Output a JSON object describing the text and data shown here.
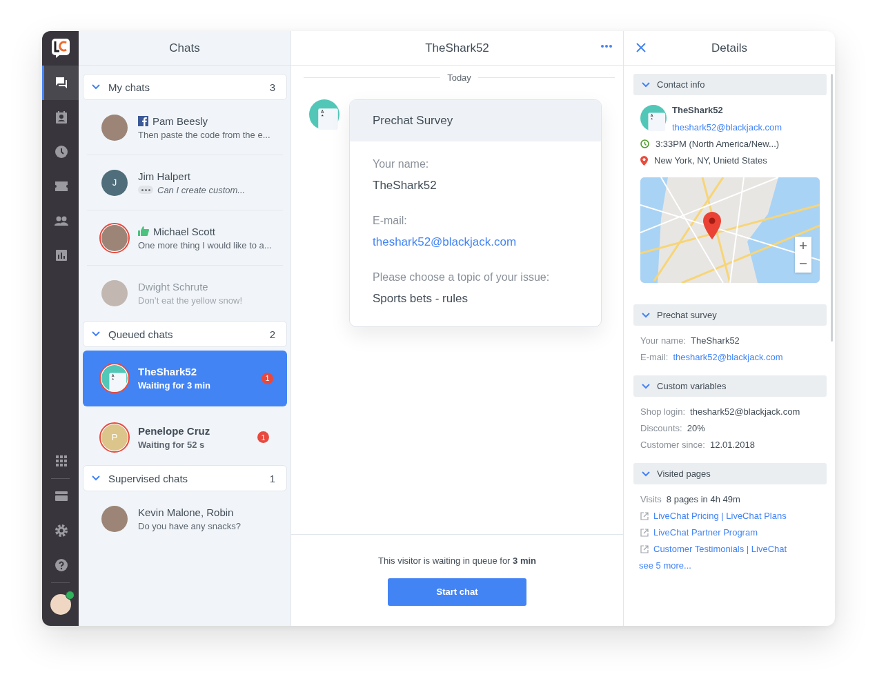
{
  "nav": {
    "items": [
      {
        "kind": "chats",
        "selected": true
      },
      {
        "kind": "contacts",
        "selected": false
      },
      {
        "kind": "history",
        "selected": false
      },
      {
        "kind": "tickets",
        "selected": false
      },
      {
        "kind": "agents",
        "selected": false
      },
      {
        "kind": "reports",
        "selected": false
      }
    ],
    "bottom": [
      {
        "kind": "apps"
      },
      {
        "kind": "billing"
      },
      {
        "kind": "settings"
      },
      {
        "kind": "help"
      }
    ],
    "user": {
      "online": true
    }
  },
  "chats": {
    "title": "Chats",
    "sections": [
      {
        "title": "My chats",
        "count": "3",
        "expanded": true,
        "items": [
          {
            "name": "Pam Beesly",
            "message": "Then paste the code from the e...",
            "kind": "photo",
            "channel": {
              "kind": "facebook"
            },
            "typing": false,
            "ring": false,
            "dimmed": false,
            "selected": false
          },
          {
            "name": "Jim Halpert",
            "message": "Can I create custom...",
            "kind": "initial",
            "initial": "J",
            "color": "#4f6d7a",
            "typing": true,
            "ring": false,
            "dimmed": false,
            "selected": false
          },
          {
            "name": "Michael Scott",
            "message": "One more thing I would like to a...",
            "kind": "photo",
            "channel": {
              "kind": "thumbs-up"
            },
            "typing": false,
            "ring": true,
            "dimmed": false,
            "selected": false
          },
          {
            "name": "Dwight Schrute",
            "message": "Don’t eat the yellow snow!",
            "kind": "photo",
            "typing": false,
            "ring": false,
            "dimmed": true,
            "selected": false
          }
        ]
      },
      {
        "title": "Queued chats",
        "count": "2",
        "expanded": true,
        "items": [
          {
            "name": "TheShark52",
            "message": "Waiting for 3 min",
            "kind": "card",
            "typing": false,
            "ring": true,
            "dimmed": false,
            "selected": true,
            "badge": "1"
          },
          {
            "name": "Penelope Cruz",
            "message": "Waiting for 52 s",
            "kind": "initial",
            "initial": "P",
            "color": "#dcc58a",
            "typing": false,
            "ring": true,
            "dimmed": false,
            "selected": false,
            "badge": "1"
          }
        ]
      },
      {
        "title": "Supervised chats",
        "count": "1",
        "expanded": true,
        "items": [
          {
            "name": "Kevin Malone, Robin",
            "message": "Do you have any snacks?",
            "kind": "photo",
            "typing": false,
            "ring": false,
            "dimmed": false,
            "selected": false
          }
        ]
      }
    ]
  },
  "conversation": {
    "title": "TheShark52",
    "date": "Today",
    "survey": {
      "title": "Prechat Survey",
      "fields": [
        {
          "label": "Your name:",
          "value": "TheShark52",
          "kind": "text"
        },
        {
          "label": "E-mail:",
          "value": "theshark52@blackjack.com",
          "kind": "link"
        },
        {
          "label": "Please choose a topic of your issue:",
          "value": "Sports bets - rules",
          "kind": "text"
        }
      ]
    },
    "queue_notice": "This visitor is waiting in queue for **3 min**",
    "button": "Start chat"
  },
  "details": {
    "title": "Details",
    "sections": [
      {
        "kind": "contact",
        "title": "Contact info",
        "expanded": true,
        "name": "TheShark52",
        "email": "theshark52@blackjack.com",
        "time": "3:33PM (North America/New...)",
        "location": "New York, NY, Unietd States"
      },
      {
        "kind": "fields",
        "title": "Prechat survey",
        "expanded": true,
        "rows": [
          {
            "label": "Your name:",
            "value": "TheShark52",
            "kind": "text"
          },
          {
            "label": "E-mail:",
            "value": "theshark52@blackjack.com",
            "kind": "link"
          }
        ]
      },
      {
        "kind": "fields",
        "title": "Custom variables",
        "expanded": true,
        "rows": [
          {
            "label": "Shop login:",
            "value": "theshark52@blackjack.com",
            "kind": "text"
          },
          {
            "label": "Discounts:",
            "value": "20%",
            "kind": "text"
          },
          {
            "label": "Customer since:",
            "value": "12.01.2018",
            "kind": "text"
          }
        ]
      },
      {
        "kind": "pages",
        "title": "Visited pages",
        "expanded": true,
        "visits_label": "Visits",
        "visits": "8 pages in 4h 49m",
        "links": [
          "LiveChat Pricing | LiveChat Plans",
          "LiveChat Partner Program",
          "Customer Testimonials | LiveChat"
        ],
        "more": "see 5 more..."
      }
    ]
  }
}
